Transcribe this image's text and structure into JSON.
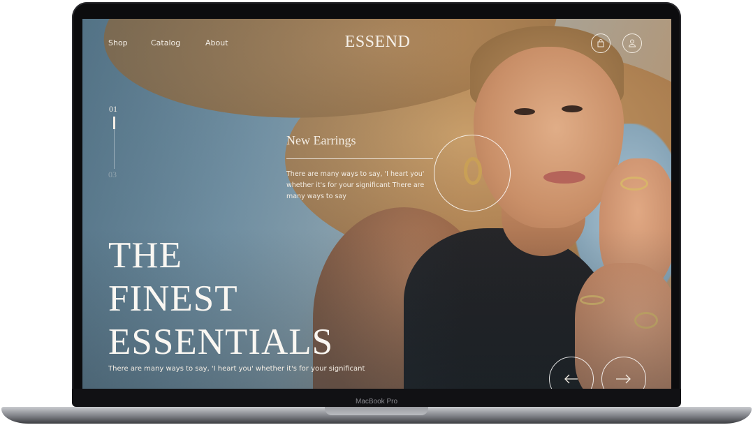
{
  "device": {
    "label": "MacBook Pro"
  },
  "nav": {
    "links": [
      "Shop",
      "Catalog",
      "About"
    ],
    "brand": "ESSEND",
    "cart_icon": "shopping-bag-icon",
    "account_icon": "user-icon"
  },
  "slider": {
    "current": "01",
    "total": "03"
  },
  "feature": {
    "title": "New Earrings",
    "text": "There are many ways to say, 'I heart you' whether it's for your significant There are many ways to say"
  },
  "hero": {
    "title_lines": [
      "THE",
      "FINEST",
      "ESSENTIALS"
    ],
    "subtitle": "There are many ways to say, 'I heart you' whether it's for your significant"
  },
  "controls": {
    "prev_icon": "arrow-left-icon",
    "next_icon": "arrow-right-icon"
  },
  "colors": {
    "text_light": "#f4efe8",
    "hat_tan": "#b48a5c",
    "sky_blue": "#7e9db0",
    "gold": "#c9a056"
  }
}
